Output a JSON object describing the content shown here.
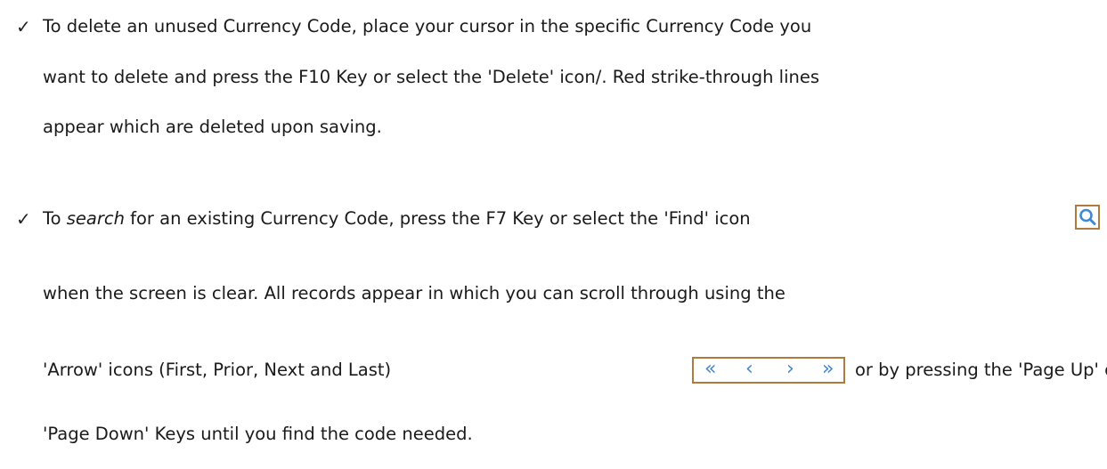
{
  "bullets": {
    "check_glyph": "✓",
    "delete": {
      "line1": "To delete an unused Currency Code, place your cursor in the specific Currency Code you",
      "line2": "want to delete and press the F10 Key or select the 'Delete' icon/.  Red strike-through lines",
      "line3": "appear which are deleted upon saving."
    },
    "search": {
      "line1_pre": "To ",
      "line1_em": "search",
      "line1_post": " for an existing Currency Code, press the F7 Key or select the 'Find' icon",
      "line2": "when the screen is clear.  All records appear in which you can scroll through using the",
      "line3_pre": "'Arrow' icons (First, Prior, Next and Last)",
      "line3_post": "or by pressing the 'Page Up' or",
      "line4": "'Page Down' Keys until you find the code needed."
    }
  },
  "icons": {
    "find": "search-icon",
    "nav": [
      "first-record-icon",
      "prior-record-icon",
      "next-record-icon",
      "last-record-icon"
    ],
    "accent_color": "#3f89d4",
    "border_color": "#b07a3e"
  }
}
